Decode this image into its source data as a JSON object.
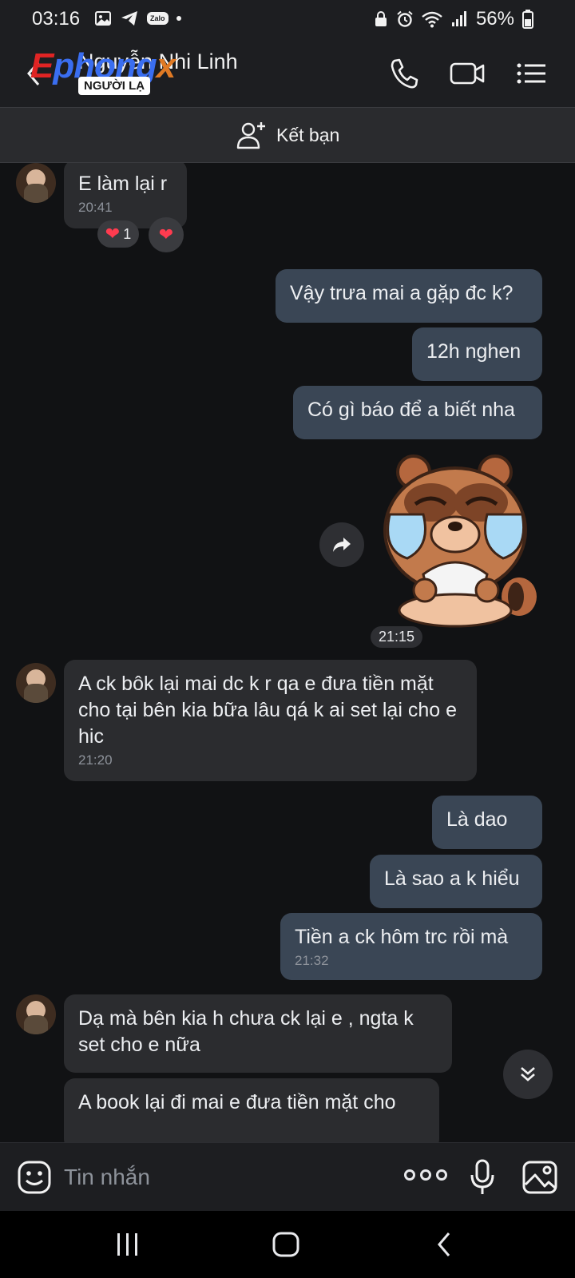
{
  "status_bar": {
    "time": "03:16",
    "zalo_label": "Zalo",
    "battery": "56%"
  },
  "header": {
    "watermark": "Ephongx",
    "contact_name": "Nguyễn Nhi Linh",
    "stranger_badge": "NGƯỜI LẠ"
  },
  "friend_bar": {
    "label": "Kết bạn"
  },
  "messages": [
    {
      "id": "m1",
      "dir": "in",
      "text": "E làm lại r",
      "time": "20:41",
      "reactions": [
        {
          "emoji": "❤️",
          "count": "1"
        },
        {
          "emoji": "❤️"
        }
      ]
    },
    {
      "id": "m2",
      "dir": "out",
      "text": "Vậy trưa mai a gặp đc k?"
    },
    {
      "id": "m3",
      "dir": "out",
      "text": "12h nghen"
    },
    {
      "id": "m4",
      "dir": "out",
      "text": "Có gì báo để a biết nha"
    },
    {
      "id": "m5",
      "dir": "out",
      "type": "sticker",
      "time": "21:15"
    },
    {
      "id": "m6",
      "dir": "in",
      "text": "A ck bôk lại mai dc k r qa e đưa tiền mặt cho tại bên kia bữa lâu qá k ai set lại cho e hic",
      "time": "21:20"
    },
    {
      "id": "m7",
      "dir": "out",
      "text": "Là dao"
    },
    {
      "id": "m8",
      "dir": "out",
      "text": "Là sao a k hiểu"
    },
    {
      "id": "m9",
      "dir": "out",
      "text": "Tiền a ck hôm trc rồi mà",
      "time": "21:32"
    },
    {
      "id": "m10",
      "dir": "in",
      "text": "Dạ mà bên kia h chưa ck lại e , ngta k set cho e nữa"
    },
    {
      "id": "m11",
      "dir": "in",
      "text": "A book lại đi mai e đưa tiền mặt cho"
    }
  ],
  "input": {
    "placeholder": "Tin nhắn",
    "value": ""
  },
  "colors": {
    "background": "#111214",
    "bubble_in": "#2b2c2f",
    "bubble_out": "#3a4655",
    "bar": "#1d1e21",
    "reaction_heart": "#ff3b4f"
  },
  "icons": [
    "image-icon",
    "telegram-icon",
    "zalo-icon",
    "alarm-icon",
    "wifi-icon",
    "signal-icon",
    "battery-icon",
    "back-arrow-icon",
    "phone-icon",
    "video-call-icon",
    "menu-icon",
    "add-friend-icon",
    "share-icon",
    "scroll-down-icon",
    "emoji-icon",
    "more-icon",
    "mic-icon",
    "gallery-icon",
    "recent-apps-icon",
    "home-icon",
    "back-icon"
  ]
}
